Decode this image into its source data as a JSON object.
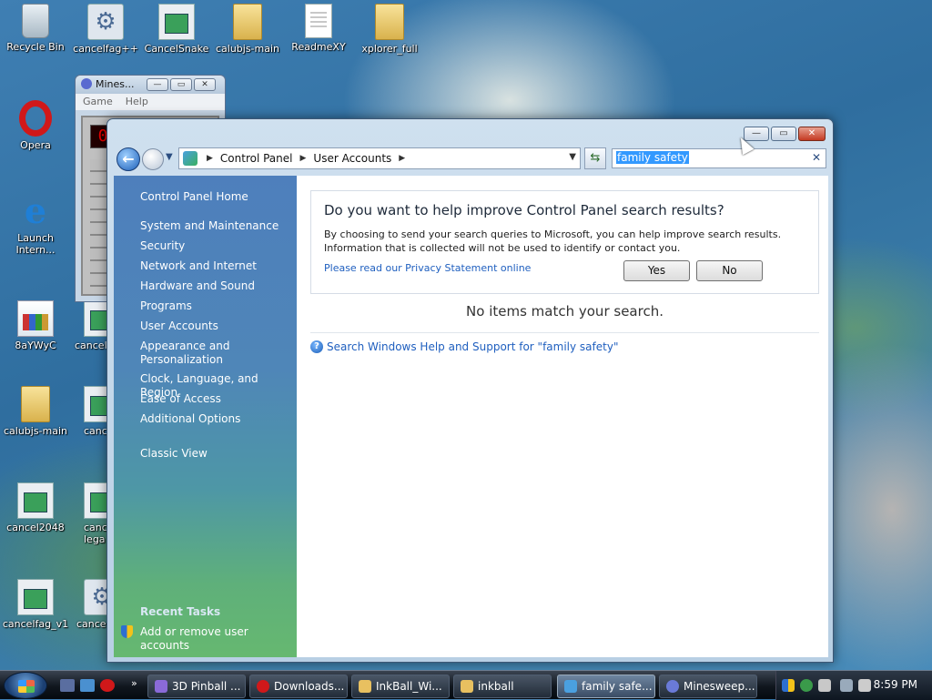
{
  "desktop": {
    "icons": [
      {
        "label": "Recycle Bin",
        "icon": "recycle-bin-icon"
      },
      {
        "label": "cancelfag++",
        "icon": "gear-shortcut-icon"
      },
      {
        "label": "CancelSnake",
        "icon": "app-window-icon"
      },
      {
        "label": "calubjs-main",
        "icon": "folder-icon"
      },
      {
        "label": "ReadmeXY",
        "icon": "text-document-icon"
      },
      {
        "label": "xplorer_full",
        "icon": "folder-icon"
      },
      {
        "label": "Opera",
        "icon": "opera-icon"
      },
      {
        "label": "Launch\nIntern...",
        "icon": "internet-explorer-icon"
      },
      {
        "label": "8aYWyC",
        "icon": "image-file-icon"
      },
      {
        "label": "calubjs-main",
        "icon": "folder-icon"
      },
      {
        "label": "cancel2048",
        "icon": "app-window-icon"
      },
      {
        "label": "cancelfag_v1",
        "icon": "app-window-icon"
      },
      {
        "label": "cancel",
        "icon": "app-window-icon"
      },
      {
        "label": "canc",
        "icon": "app-window-icon"
      },
      {
        "label": "canc\nlega",
        "icon": "app-window-icon"
      },
      {
        "label": "cance",
        "icon": "gear-shortcut-icon"
      }
    ]
  },
  "minesweeper": {
    "title": "Mines...",
    "menu": [
      "Game",
      "Help"
    ],
    "counter": "0"
  },
  "control_panel": {
    "address": {
      "crumbs": [
        "Control Panel",
        "User Accounts"
      ]
    },
    "search": {
      "value": "family safety"
    },
    "sidebar": {
      "home": "Control Panel Home",
      "items": [
        "System and Maintenance",
        "Security",
        "Network and Internet",
        "Hardware and Sound",
        "Programs",
        "User Accounts",
        "Appearance and\nPersonalization",
        "Clock, Language, and Region",
        "Ease of Access",
        "Additional Options"
      ],
      "classic_view": "Classic View",
      "recent_tasks_heading": "Recent Tasks",
      "recent_task": "Add or remove user accounts"
    },
    "prompt": {
      "question": "Do you want to help improve Control Panel search results?",
      "body": "By choosing to send your search queries to Microsoft, you can help improve search results. Information that is collected will not be used to identify or contact you.",
      "privacy_link": "Please read our Privacy Statement online",
      "yes": "Yes",
      "no": "No"
    },
    "no_items": "No items match your search.",
    "help_search": "Search Windows Help and Support for \"family safety\""
  },
  "taskbar": {
    "tasks": [
      {
        "label": "3D Pinball ...",
        "icon_color": "#8a6ad8"
      },
      {
        "label": "Downloads...",
        "icon_color": "#d0181a"
      },
      {
        "label": "InkBall_Wi...",
        "icon_color": "#e8c060"
      },
      {
        "label": "inkball",
        "icon_color": "#e8c060"
      },
      {
        "label": "family safe...",
        "icon_color": "#4aa0e0"
      },
      {
        "label": "Minesweep...",
        "icon_color": "#6a7ad8"
      }
    ],
    "clock": "8:59 PM"
  }
}
